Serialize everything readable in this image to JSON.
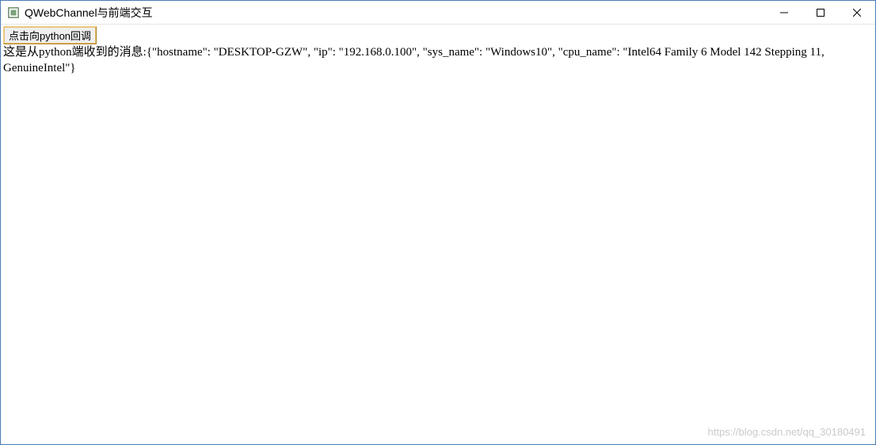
{
  "window": {
    "title": "QWebChannel与前端交互"
  },
  "content": {
    "button_label": "点击向python回调",
    "message": "这是从python端收到的消息:{\"hostname\": \"DESKTOP-GZW\", \"ip\": \"192.168.0.100\", \"sys_name\": \"Windows10\", \"cpu_name\": \"Intel64 Family 6 Model 142 Stepping 11, GenuineIntel\"}"
  },
  "watermark": "https://blog.csdn.net/qq_30180491"
}
